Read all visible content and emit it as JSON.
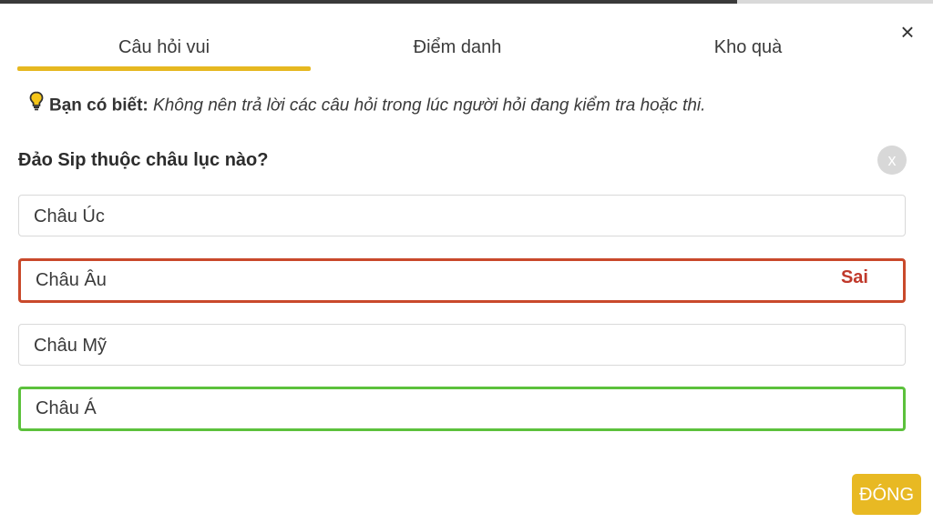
{
  "tabs": [
    {
      "label": "Câu hỏi vui"
    },
    {
      "label": "Điểm danh"
    },
    {
      "label": "Kho quà"
    }
  ],
  "close_icon": "×",
  "tip": {
    "icon": "lightbulb-icon",
    "label": "Bạn có biết:",
    "text": "Không nên trả lời các câu hỏi trong lúc người hỏi đang kiểm tra hoặc thi."
  },
  "question": {
    "text": "Đảo Sip thuộc châu lục nào?",
    "dismiss_glyph": "x"
  },
  "options": [
    {
      "text": "Châu Úc"
    },
    {
      "text": "Châu Âu",
      "verdict": "Sai"
    },
    {
      "text": "Châu Mỹ"
    },
    {
      "text": "Châu Á"
    }
  ],
  "close_button": {
    "label": "ĐÓNG"
  },
  "colors": {
    "accent": "#e6b820",
    "wrong": "#c9492b",
    "correct": "#5cc13c"
  }
}
